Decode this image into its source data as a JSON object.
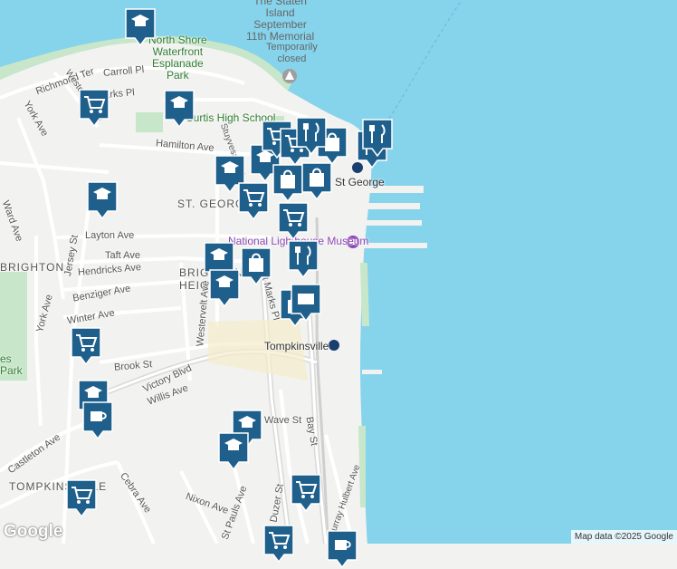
{
  "colors": {
    "water": "#86d3ec",
    "land": "#f2f2f0",
    "park": "#c8e6c9",
    "road": "#ffffff",
    "major_road": "#d9d9d9",
    "pin": "#1f5f8b",
    "rail": "#cfcfcf"
  },
  "area_labels": [
    "ST. GEORGE",
    "BRIGHTON",
    "BRIGHTON HEIGHTS",
    "TOMPKINSVILLE"
  ],
  "poi_labels": {
    "memorial": [
      "The Staten",
      "Island",
      "September",
      "11th Memorial"
    ],
    "memorial_status": [
      "Temporarily",
      "closed"
    ],
    "esplanade": [
      "North Shore",
      "Waterfront",
      "Esplanade",
      "Park"
    ],
    "school": "Curtis High School",
    "museum": "National Lighthouse Museum",
    "st_george": "St George",
    "tompkinsville": "Tompkinsville",
    "park_fragment": [
      "es",
      "Park"
    ]
  },
  "road_labels": [
    "Richmond Ter",
    "Carroll Pl",
    "Westervelt Ave",
    "Marks Pl",
    "York Ave",
    "Hamilton Ave",
    "Stuyvesant Pl",
    "Layton Ave",
    "Taft Ave",
    "Hendricks Ave",
    "Benziger Ave",
    "Winter Ave",
    "Westervelt Ave",
    "St Marks Pl",
    "Brook St",
    "Victory Blvd",
    "Willis Ave",
    "Jersey St",
    "York Ave",
    "Castleton Ave",
    "Cebra Ave",
    "Nixon Ave",
    "St Pauls Ave",
    "Van Duzer St",
    "Bay St",
    "Murray Hulbert Ave",
    "Wave St",
    "Ward Ave"
  ],
  "markers": [
    {
      "type": "school-icon"
    },
    {
      "type": "school-icon"
    },
    {
      "type": "school-icon"
    },
    {
      "type": "school-icon"
    },
    {
      "type": "school-icon"
    },
    {
      "type": "school-icon"
    },
    {
      "type": "school-icon"
    },
    {
      "type": "school-icon"
    },
    {
      "type": "school-icon"
    },
    {
      "type": "school-icon"
    },
    {
      "type": "cart-icon"
    },
    {
      "type": "cart-icon"
    },
    {
      "type": "cart-icon"
    },
    {
      "type": "cart-icon"
    },
    {
      "type": "cart-icon"
    },
    {
      "type": "cart-icon"
    },
    {
      "type": "cart-icon"
    },
    {
      "type": "cart-icon"
    },
    {
      "type": "cart-icon"
    },
    {
      "type": "bag-icon"
    },
    {
      "type": "bag-icon"
    },
    {
      "type": "bag-icon"
    },
    {
      "type": "bag-icon"
    },
    {
      "type": "bag-icon"
    },
    {
      "type": "fork-knife-icon"
    },
    {
      "type": "fork-knife-icon"
    },
    {
      "type": "fork-knife-icon"
    },
    {
      "type": "fork-knife-icon"
    },
    {
      "type": "cup-icon"
    },
    {
      "type": "cup-icon"
    },
    {
      "type": "atm-icon"
    }
  ],
  "logo": "Google",
  "attribution": "Map data ©2025 Google"
}
